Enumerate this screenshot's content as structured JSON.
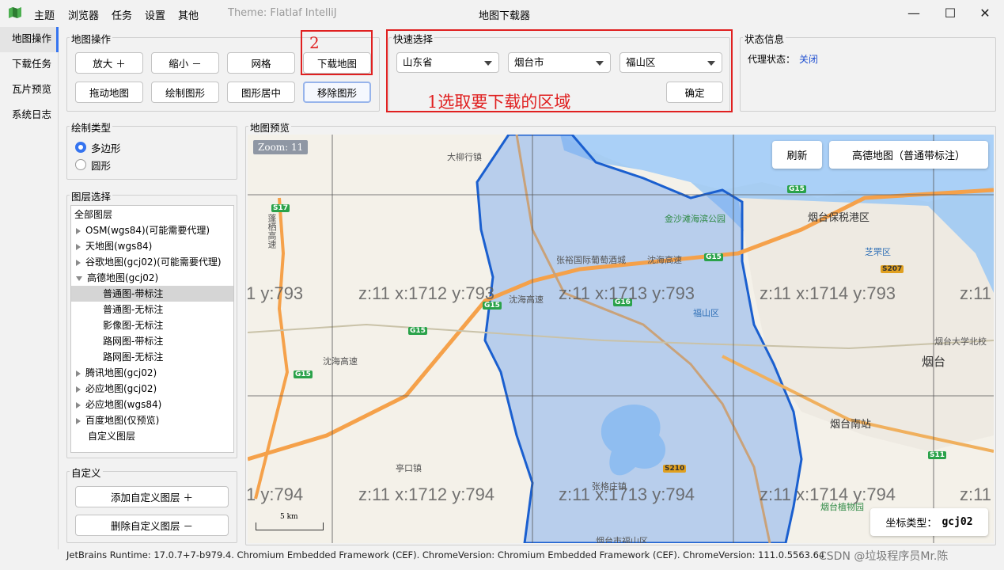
{
  "menubar": {
    "items": [
      "主题",
      "浏览器",
      "任务",
      "设置",
      "其他"
    ],
    "theme": "Theme: Flatlaf IntelliJ",
    "title": "地图下载器"
  },
  "window_buttons": {
    "minimize": "—",
    "maximize": "☐",
    "close": "✕"
  },
  "nav": {
    "items": [
      "地图操作",
      "下载任务",
      "瓦片预览",
      "系统日志"
    ],
    "active_index": 0
  },
  "map_ops": {
    "title": "地图操作",
    "buttons": [
      "放大 ＋",
      "缩小 －",
      "网格",
      "下载地图",
      "拖动地图",
      "绘制图形",
      "图形居中",
      "移除图形"
    ]
  },
  "quick_select": {
    "title": "快速选择",
    "province": "山东省",
    "city": "烟台市",
    "district": "福山区",
    "confirm": "确定"
  },
  "annotations": {
    "step1": "1选取要下载的区域",
    "step2": "2"
  },
  "status_info": {
    "title": "状态信息",
    "proxy_label": "代理状态：",
    "proxy_value": "关闭"
  },
  "draw_type": {
    "title": "绘制类型",
    "options": [
      "多边形",
      "圆形"
    ],
    "selected": 0
  },
  "layers": {
    "title": "图层选择",
    "items": [
      {
        "label": "全部图层",
        "level": 0,
        "toggle": "none"
      },
      {
        "label": "OSM(wgs84)(可能需要代理)",
        "level": 1,
        "toggle": "collapsed"
      },
      {
        "label": "天地图(wgs84)",
        "level": 1,
        "toggle": "collapsed"
      },
      {
        "label": "谷歌地图(gcj02)(可能需要代理)",
        "level": 1,
        "toggle": "collapsed"
      },
      {
        "label": "高德地图(gcj02)",
        "level": 1,
        "toggle": "expanded"
      },
      {
        "label": "普通图-带标注",
        "level": 2,
        "toggle": "none",
        "selected": true
      },
      {
        "label": "普通图-无标注",
        "level": 2,
        "toggle": "none"
      },
      {
        "label": "影像图-无标注",
        "level": 2,
        "toggle": "none"
      },
      {
        "label": "路网图-带标注",
        "level": 2,
        "toggle": "none"
      },
      {
        "label": "路网图-无标注",
        "level": 2,
        "toggle": "none"
      },
      {
        "label": "腾讯地图(gcj02)",
        "level": 1,
        "toggle": "collapsed"
      },
      {
        "label": "必应地图(gcj02)",
        "level": 1,
        "toggle": "collapsed"
      },
      {
        "label": "必应地图(wgs84)",
        "level": 1,
        "toggle": "collapsed"
      },
      {
        "label": "百度地图(仅预览)",
        "level": 1,
        "toggle": "collapsed"
      },
      {
        "label": "自定义图层",
        "level": 1,
        "toggle": "none"
      }
    ]
  },
  "custom": {
    "title": "自定义",
    "add": "添加自定义图层 ＋",
    "remove": "删除自定义图层 －"
  },
  "map_preview": {
    "title": "地图预览",
    "zoom": "Zoom: 11",
    "refresh": "刷新",
    "layer_button": "高德地图（普通带标注）",
    "coord_label": "坐标类型：",
    "coord_value": "gcj02",
    "scale": "5 km",
    "tile_labels": [
      "1 y:793",
      "z:11 x:1712 y:793",
      "z:11 x:1713 y:793",
      "z:11 x:1714 y:793",
      "z:11",
      "1 y:794",
      "z:11 x:1712 y:794",
      "z:11 x:1713 y:794",
      "z:11 x:1714 y:794",
      "z:11"
    ],
    "pois": [
      "大柳行镇",
      "金沙滩海滨公园",
      "烟台保税港区",
      "张裕国际葡萄酒城",
      "芝罘区",
      "福山区",
      "烟台大学北校",
      "烟台",
      "烟台南站",
      "亭口镇",
      "张格庄镇",
      "烟台市福山区",
      "烟台植物园",
      "沈海高速",
      "沈海高速",
      "蓬栖高速",
      "沈海高速"
    ],
    "road_shields": [
      "S17",
      "G15",
      "G15",
      "G15",
      "G15",
      "S207",
      "S210",
      "S11",
      "G15",
      "G16"
    ]
  },
  "statusbar": "JetBrains Runtime: 17.0.7+7-b979.4. Chromium Embedded Framework (CEF). ChromeVersion: Chromium Embedded Framework (CEF). ChromeVersion: 111.0.5563.64",
  "watermark": "CSDN @垃圾程序员Mr.陈"
}
